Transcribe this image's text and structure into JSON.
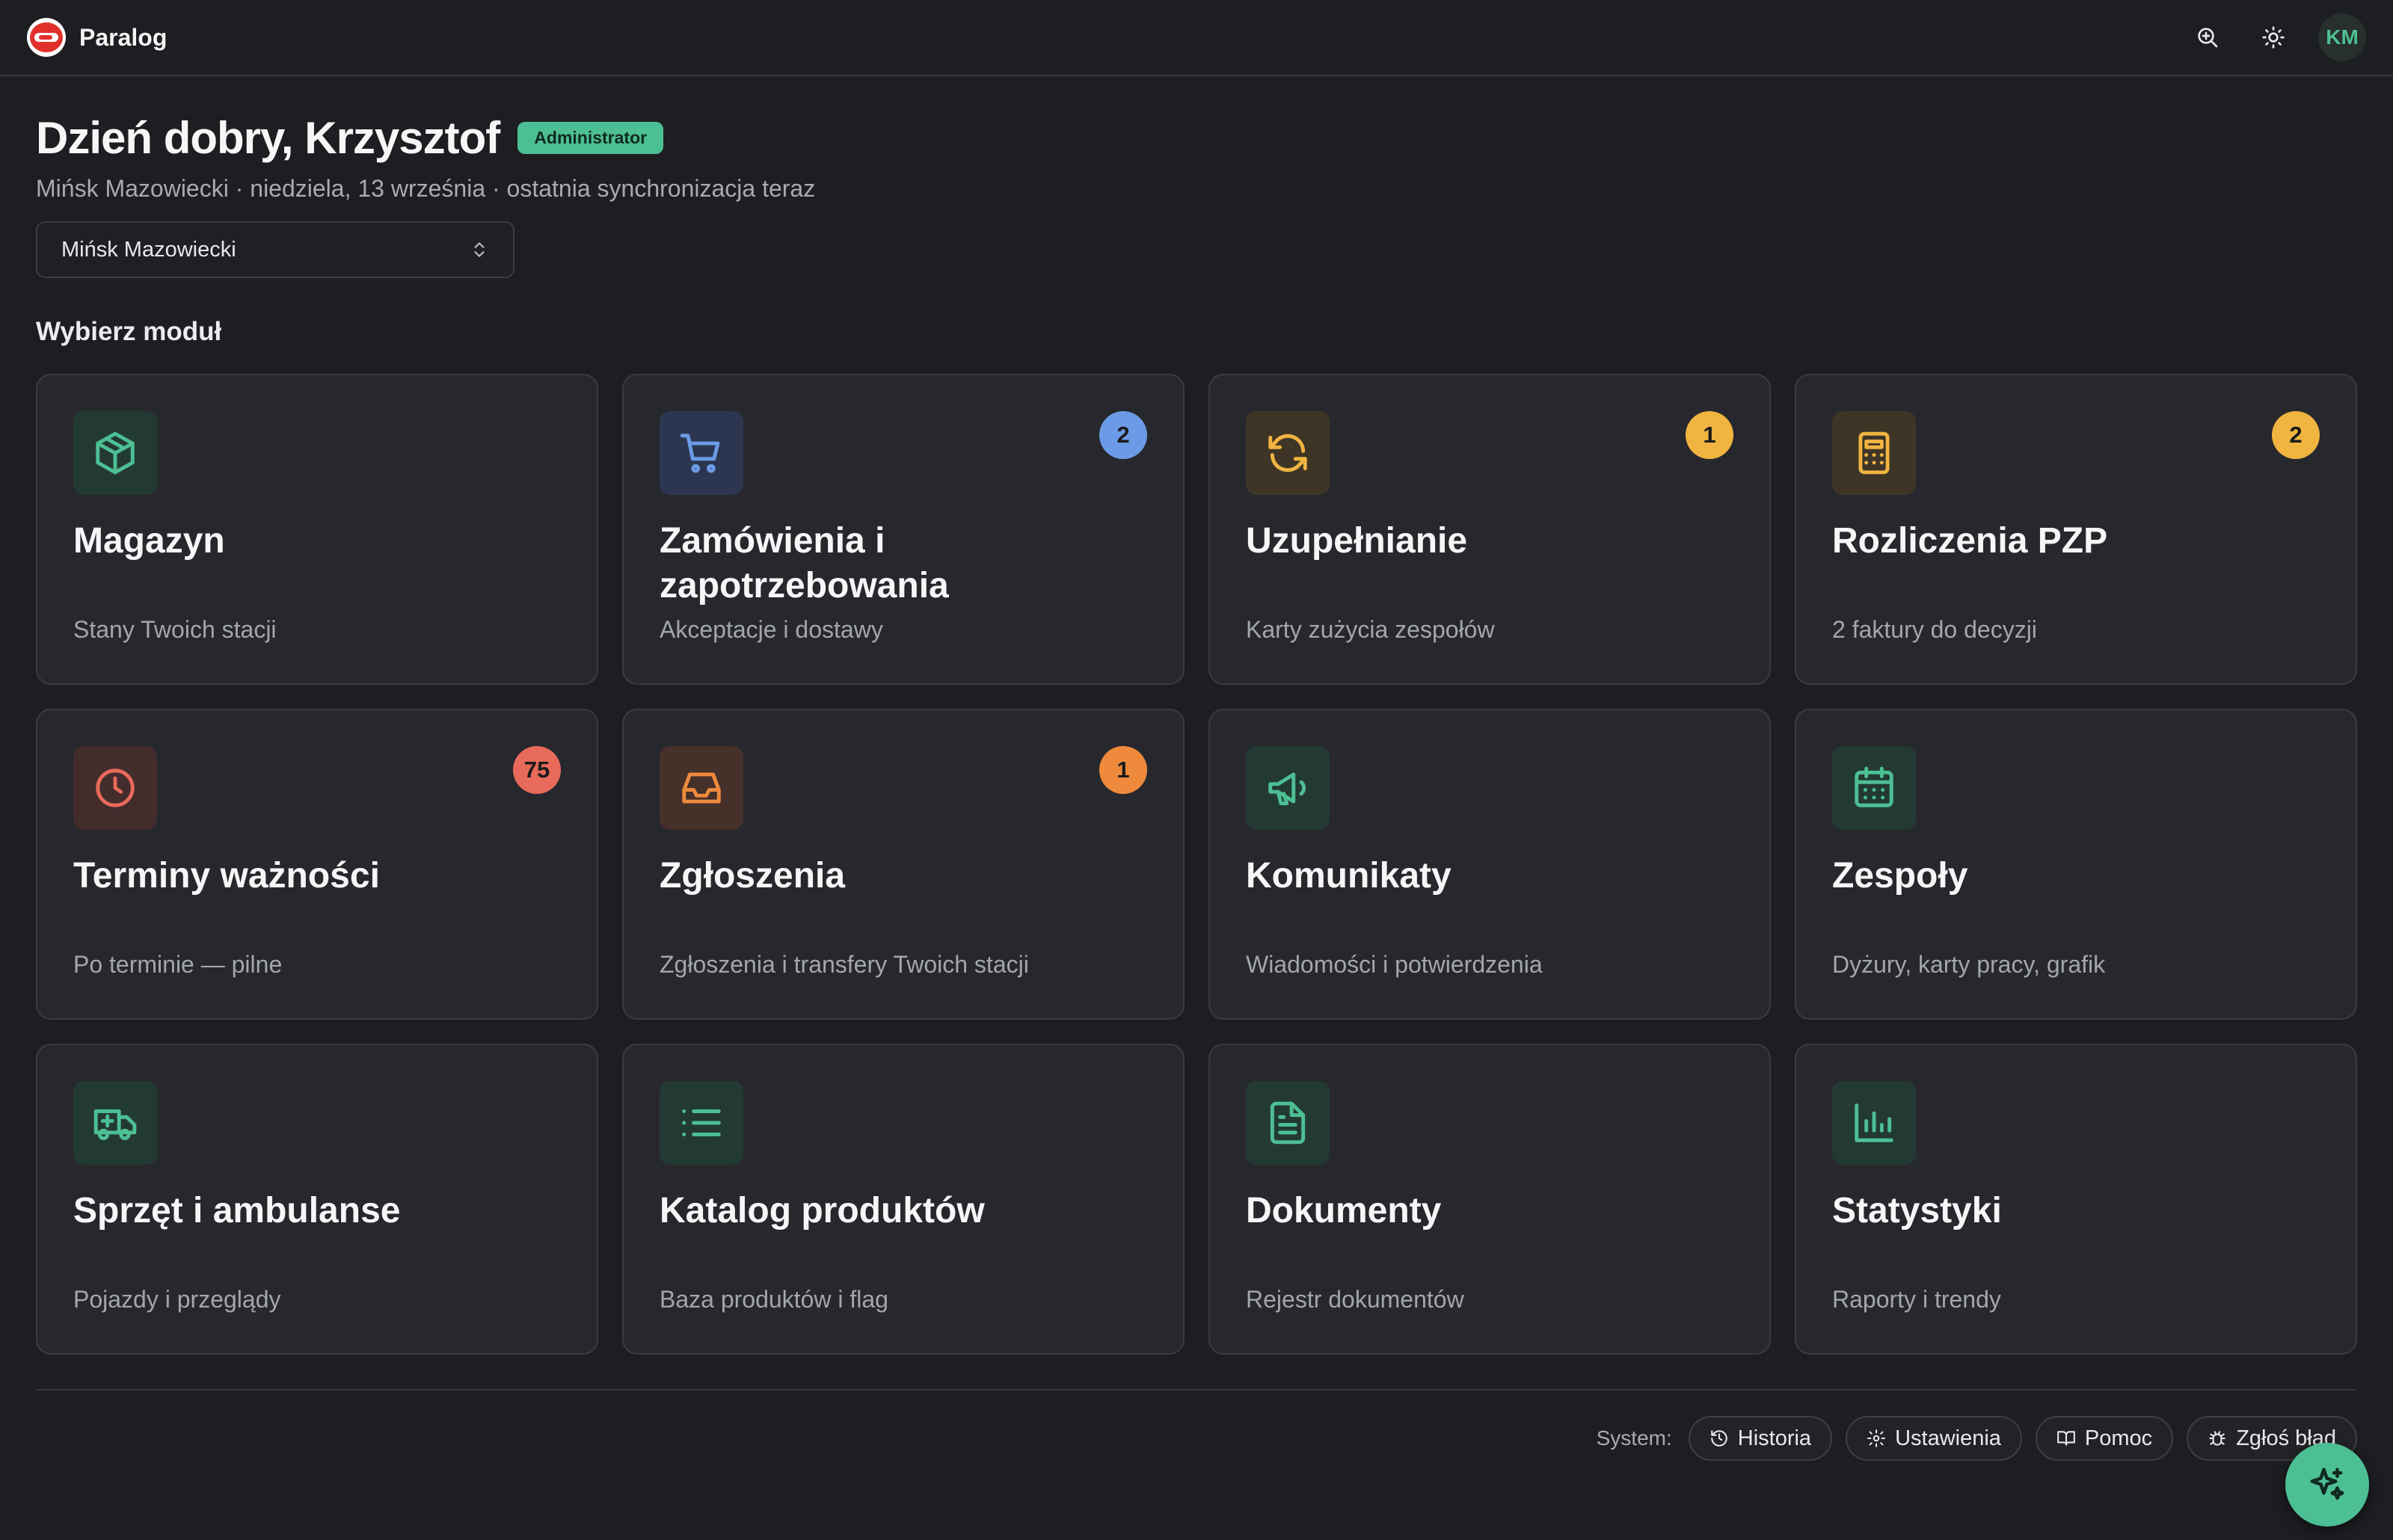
{
  "app": {
    "name": "Paralog"
  },
  "header": {
    "avatar_initials": "KM"
  },
  "greeting": {
    "text": "Dzień dobry, Krzysztof",
    "role": "Administrator"
  },
  "subline": "Mińsk Mazowiecki · niedziela, 13 września · ostatnia synchronizacja teraz",
  "station_select": {
    "value": "Mińsk Mazowiecki"
  },
  "section_title": "Wybierz moduł",
  "modules": [
    {
      "title": "Magazyn",
      "desc": "Stany Twoich stacji",
      "icon": "box-icon",
      "accent": "#4dbf94",
      "tile": "t-green"
    },
    {
      "title": "Zamówienia i zapotrzebowania",
      "desc": "Akceptacje i dostawy",
      "icon": "cart-icon",
      "accent": "#6b9be6",
      "tile": "t-blue",
      "badge": "2",
      "badge_color": "#6b9be6"
    },
    {
      "title": "Uzupełnianie",
      "desc": "Karty zużycia zespołów",
      "icon": "refresh-icon",
      "accent": "#f0b440",
      "tile": "t-amber",
      "badge": "1",
      "badge_color": "#f0b440"
    },
    {
      "title": "Rozliczenia PZP",
      "desc": "2 faktury do decyzji",
      "icon": "calculator-icon",
      "accent": "#f0b440",
      "tile": "t-amber",
      "badge": "2",
      "badge_color": "#f0b440"
    },
    {
      "title": "Terminy ważności",
      "desc": "Po terminie — pilne",
      "icon": "clock-icon",
      "accent": "#e86a5a",
      "tile": "t-red",
      "badge": "75",
      "badge_color": "#e86a5a"
    },
    {
      "title": "Zgłoszenia",
      "desc": "Zgłoszenia i transfery Twoich stacji",
      "icon": "inbox-icon",
      "accent": "#ef8a3c",
      "tile": "t-orange",
      "badge": "1",
      "badge_color": "#ef8a3c"
    },
    {
      "title": "Komunikaty",
      "desc": "Wiadomości i potwierdzenia",
      "icon": "megaphone-icon",
      "accent": "#4dbf94",
      "tile": "t-green"
    },
    {
      "title": "Zespoły",
      "desc": "Dyżury, karty pracy, grafik",
      "icon": "calendar-icon",
      "accent": "#4dbf94",
      "tile": "t-green"
    },
    {
      "title": "Sprzęt i ambulanse",
      "desc": "Pojazdy i przeglądy",
      "icon": "ambulance-icon",
      "accent": "#4dbf94",
      "tile": "t-green"
    },
    {
      "title": "Katalog produktów",
      "desc": "Baza produktów i flag",
      "icon": "list-icon",
      "accent": "#4dbf94",
      "tile": "t-green"
    },
    {
      "title": "Dokumenty",
      "desc": "Rejestr dokumentów",
      "icon": "document-icon",
      "accent": "#4dbf94",
      "tile": "t-green"
    },
    {
      "title": "Statystyki",
      "desc": "Raporty i trendy",
      "icon": "bar-chart-icon",
      "accent": "#4dbf94",
      "tile": "t-green"
    }
  ],
  "footer": {
    "label": "System:",
    "items": [
      {
        "label": "Historia",
        "icon": "history-icon"
      },
      {
        "label": "Ustawienia",
        "icon": "gear-icon"
      },
      {
        "label": "Pomoc",
        "icon": "book-icon"
      },
      {
        "label": "Zgłoś błąd",
        "icon": "bug-icon"
      }
    ]
  },
  "fab": {
    "icon": "sparkles-icon"
  }
}
